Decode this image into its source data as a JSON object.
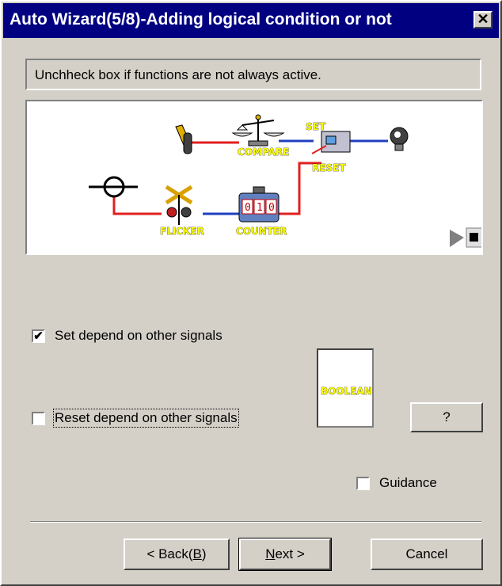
{
  "window": {
    "title": "Auto Wizard(5/8)-Adding logical condition or not",
    "close_glyph": "✕"
  },
  "hint": "Unchheck box if functions are not always active.",
  "diagram": {
    "labels": {
      "compare": "COMPARE",
      "set": "SET",
      "reset": "RESET",
      "flicker": "FLICKER",
      "counter": "COUNTER",
      "counter_digits": [
        "0",
        "1",
        "0"
      ]
    },
    "icons": [
      "switch-icon",
      "compare-scale-icon",
      "set-reset-icon",
      "light-bulb-icon",
      "signal-icon",
      "flicker-crossing-icon",
      "counter-icon",
      "play-icon",
      "stop-icon"
    ]
  },
  "options": {
    "set_depend": {
      "label": "Set depend on other signals",
      "checked": true,
      "mark": "✔"
    },
    "reset_depend": {
      "label": "Reset depend on other signals",
      "checked": false
    }
  },
  "preview": {
    "label": "BOOLEAN"
  },
  "help_button": "?",
  "guidance": {
    "label": "Guidance",
    "checked": false
  },
  "buttons": {
    "back_prefix": "< Back(",
    "back_key": "B",
    "back_suffix": ")",
    "next_key": "N",
    "next_rest": "ext >",
    "cancel": "Cancel"
  },
  "colors": {
    "title_bg": "#000080",
    "face": "#d4d0c8",
    "wire_red": "#e02020",
    "wire_blue": "#2040c0"
  }
}
